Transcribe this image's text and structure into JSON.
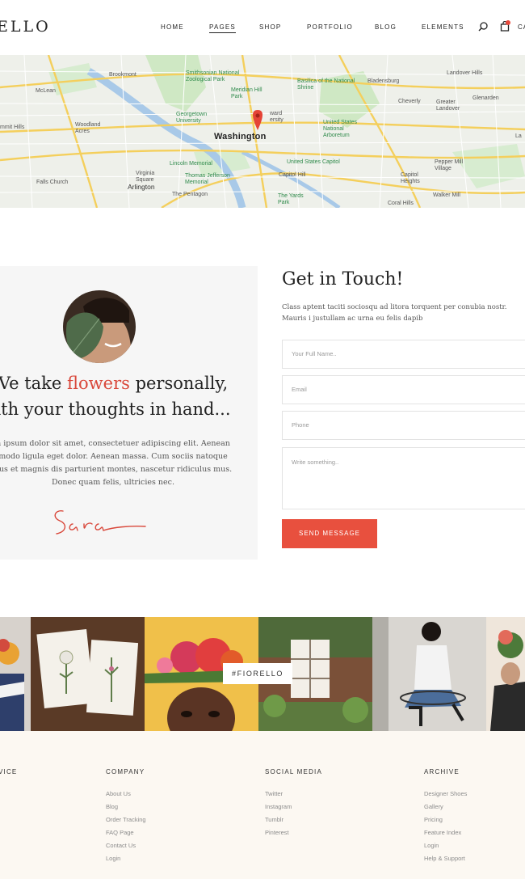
{
  "header": {
    "logo": "ELLO",
    "nav": [
      "HOME",
      "PAGES",
      "SHOP",
      "PORTFOLIO",
      "BLOG",
      "ELEMENTS"
    ],
    "active_nav": "PAGES",
    "cart_label": "CA"
  },
  "map": {
    "pin_city": "Washington",
    "labels": [
      "Brookmont",
      "Smithsonian National Zoological Park",
      "Basilica of the National Shrine",
      "Bladensburg",
      "Landover Hills",
      "McLean",
      "Cheverly",
      "Glenarden",
      "Greater Landover",
      "mmit Hills",
      "Woodland Acres",
      "Georgetown University",
      "Meridian Hill Park",
      "ward ersity",
      "United States National Arboretum",
      "Lincoln Memorial",
      "United States Capitol",
      "Pepper Mill Village",
      "Falls Church",
      "Arlington",
      "Virginia Square",
      "Thomas Jefferson Memorial",
      "Capitol Heights",
      "The Pentagon",
      "The Yards Park",
      "Walker Mill",
      "Coral Hills",
      "La",
      "Capitol Hill"
    ]
  },
  "about": {
    "line1_prefix": "Ve take ",
    "line1_accent": "flowers",
    "line1_suffix": " personally,",
    "line2": "ith your thoughts in hand...",
    "body": [
      "n ipsum dolor sit amet, consectetuer adipiscing elit. Aenean",
      "modo ligula eget dolor. Aenean massa. Cum sociis natoque",
      "bus et magnis dis parturient montes, nascetur ridiculus mus.",
      "Donec quam felis, ultricies nec."
    ],
    "signature": "Sara"
  },
  "contact": {
    "title": "Get in Touch!",
    "intro": "Class aptent taciti sociosqu ad litora torquent per conubia nostr. Mauris i justullam ac urna eu felis dapib",
    "name_placeholder": "Your Full Name..",
    "email_placeholder": "Email",
    "phone_placeholder": "Phone",
    "message_placeholder": "Write something..",
    "send_label": "SEND MESSAGE"
  },
  "instagram": {
    "tag": "#FIORELLO"
  },
  "footer": {
    "columns": [
      {
        "title": "VICE",
        "items": [
          "",
          "",
          ""
        ]
      },
      {
        "title": "COMPANY",
        "items": [
          "About Us",
          "Blog",
          "Order Tracking",
          "FAQ Page",
          "Contact Us",
          "Login"
        ]
      },
      {
        "title": "SOCIAL MEDIA",
        "items": [
          "Twitter",
          "Instagram",
          "Tumblr",
          "Pinterest"
        ]
      },
      {
        "title": "ARCHIVE",
        "items": [
          "Designer Shoes",
          "Gallery",
          "Pricing",
          "Feature Index",
          "Login",
          "Help & Support"
        ]
      }
    ]
  },
  "colors": {
    "accent": "#e8503e",
    "footer_bg": "#fcf8f2",
    "panel_bg": "#f6f6f6"
  }
}
